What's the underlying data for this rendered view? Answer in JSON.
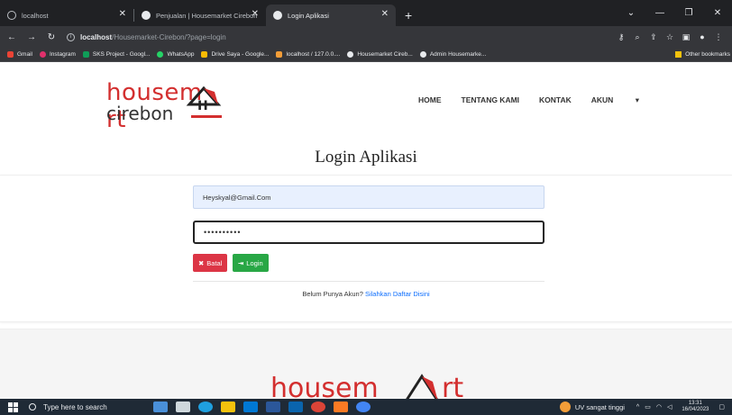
{
  "browser": {
    "tabs": [
      {
        "title": "localhost",
        "active": false
      },
      {
        "title": "Penjualan | Housemarket Cirebon",
        "active": false
      },
      {
        "title": "Login Aplikasi",
        "active": true
      }
    ],
    "new_tab": "+",
    "address": {
      "host": "localhost",
      "path": "/Housemarket-Cirebon/?page=login"
    },
    "bookmarks": [
      {
        "label": "Gmail",
        "color": "#ea4335"
      },
      {
        "label": "Instagram",
        "color": "#e1306c"
      },
      {
        "label": "SKS Project - Googl...",
        "color": "#0f9d58"
      },
      {
        "label": "WhatsApp",
        "color": "#25d366"
      },
      {
        "label": "Drive Saya - Google...",
        "color": "#fbbc04"
      },
      {
        "label": "localhost / 127.0.0....",
        "color": "#f29d38"
      },
      {
        "label": "Housemarket Cireb...",
        "color": "#e8eaed"
      },
      {
        "label": "Admin Housemarke...",
        "color": "#e8eaed"
      }
    ],
    "other_bookmarks": "Other bookmarks"
  },
  "site": {
    "logo_top": "housem",
    "logo_top_end": "rt",
    "logo_bottom": "cirebon",
    "brand_color": "#d32f2f",
    "menu": [
      "HOME",
      "TENTANG KAMI",
      "KONTAK",
      "AKUN"
    ],
    "menu_dropdown": "▾"
  },
  "login": {
    "title": "Login Aplikasi",
    "email_value": "Heyskyal@Gmail.Com",
    "password_value": "••••••••••",
    "batal_label": "Batal",
    "batal_icon": "✖",
    "login_label": "Login",
    "login_icon": "⇥",
    "signup_text": "Belum Punya Akun?",
    "signup_link": "Silahkan Daftar Disini"
  },
  "footer": {
    "logo_text": "housem",
    "logo_end": "rt"
  },
  "taskbar": {
    "search_placeholder": "Type here to search",
    "weather": "UV sangat tinggi",
    "time": "13:31",
    "date": "16/04/2023"
  }
}
